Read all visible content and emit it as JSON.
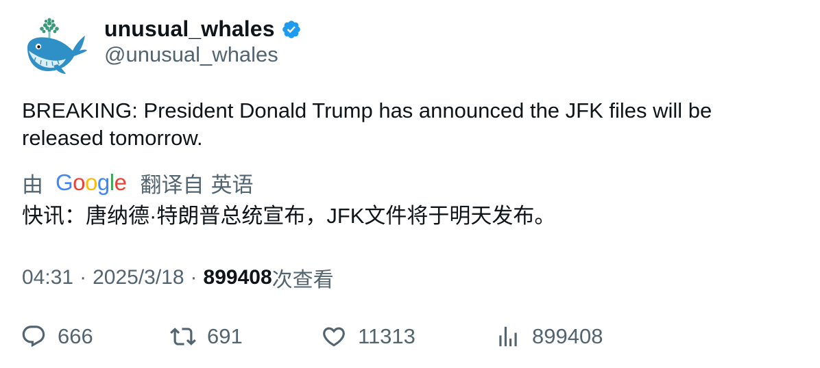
{
  "author": {
    "display_name": "unusual_whales",
    "handle": "@unusual_whales",
    "verified": true,
    "verified_color": "#1d9bf0"
  },
  "tweet": {
    "text": "BREAKING: President Donald Trump has announced the JFK files will be released tomorrow."
  },
  "translation": {
    "by_label": "由",
    "provider": "Google",
    "from_label": "翻译自",
    "language": "英语",
    "text": "快讯：唐纳德·特朗普总统宣布，JFK文件将于明天发布。"
  },
  "meta": {
    "time": "04:31",
    "separator": "·",
    "date": "2025/3/18",
    "views_count": "899408",
    "views_label": "次查看"
  },
  "actions": {
    "replies": "666",
    "retweets": "691",
    "likes": "11313",
    "views": "899408"
  },
  "icons": {
    "reply": "reply-icon",
    "retweet": "retweet-icon",
    "like": "heart-icon",
    "views": "analytics-icon",
    "verified": "verified-badge-icon"
  },
  "colors": {
    "text_primary": "#0f1419",
    "text_secondary": "#536471",
    "google_blue": "#4285f4",
    "google_red": "#ea4335",
    "google_yellow": "#fbbc05",
    "google_green": "#34a853"
  }
}
